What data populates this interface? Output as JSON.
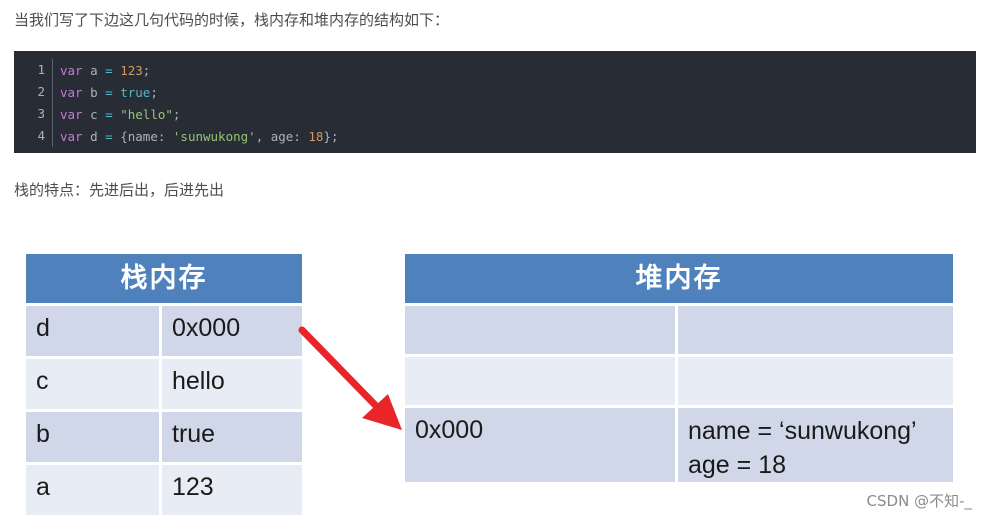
{
  "intro_text": "当我们写了下边这几句代码的时候，栈内存和堆内存的结构如下：",
  "code": {
    "lines": [
      {
        "num": "1",
        "kw": "var",
        "name": " a ",
        "op": "=",
        "value": "123",
        "value_type": "num",
        "rest": ";"
      },
      {
        "num": "2",
        "kw": "var",
        "name": " b ",
        "op": "=",
        "value": "true",
        "value_type": "bool",
        "rest": ";"
      },
      {
        "num": "3",
        "kw": "var",
        "name": " c ",
        "op": "=",
        "value": "\"hello\"",
        "value_type": "str",
        "rest": ";"
      },
      {
        "num": "4",
        "kw": "var",
        "name": " d ",
        "op": "=",
        "value": "{name: 'sunwukong', age: 18}",
        "value_type": "obj",
        "rest": ";"
      }
    ]
  },
  "note_text": "栈的特点：先进后出，后进先出",
  "stack_table": {
    "title": "栈内存",
    "rows": [
      {
        "name": "d",
        "value": "0x000"
      },
      {
        "name": "c",
        "value": "hello"
      },
      {
        "name": "b",
        "value": "true"
      },
      {
        "name": "a",
        "value": "123"
      }
    ]
  },
  "heap_table": {
    "title": "堆内存",
    "rows": [
      {
        "addr": "",
        "value_line1": "",
        "value_line2": ""
      },
      {
        "addr": "",
        "value_line1": "",
        "value_line2": ""
      },
      {
        "addr": "0x000",
        "value_line1": "name = ‘sunwukong’",
        "value_line2": "age = 18"
      }
    ]
  },
  "colors": {
    "header": "#4f81bd",
    "row_dark": "#cfd7e8",
    "row_light": "#e8ecf4",
    "arrow": "#e8262a",
    "code_bg": "#282c34"
  },
  "watermark": "CSDN @不知-_"
}
